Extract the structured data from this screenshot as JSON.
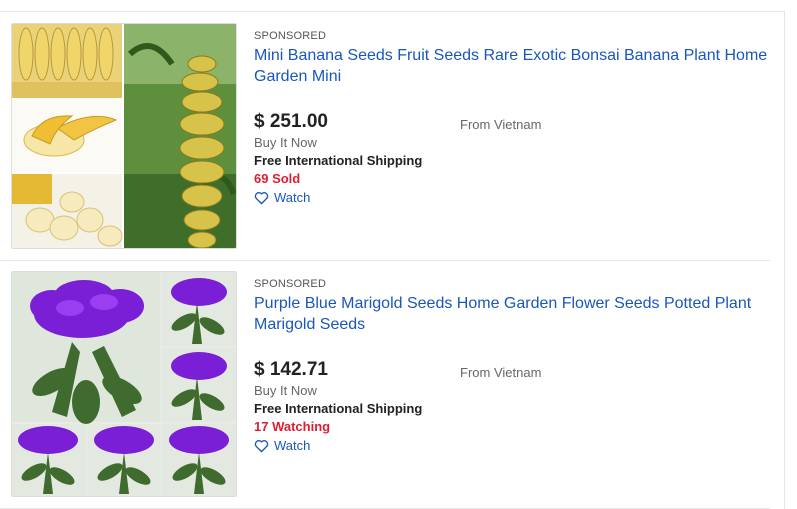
{
  "listings": [
    {
      "sponsored_label": "SPONSORED",
      "title": "Mini Banana Seeds Fruit Seeds Rare Exotic Bonsai Banana Plant Home Garden Mini",
      "price": "$ 251.00",
      "format": "Buy It Now",
      "shipping": "Free International Shipping",
      "hotness": "69 Sold",
      "location": "From Vietnam",
      "watch_label": "Watch",
      "image_icon": "banana-collage-image"
    },
    {
      "sponsored_label": "SPONSORED",
      "title": "Purple Blue Marigold Seeds Home Garden Flower Seeds Potted Plant Marigold Seeds",
      "price": "$ 142.71",
      "format": "Buy It Now",
      "shipping": "Free International Shipping",
      "hotness": "17 Watching",
      "location": "From Vietnam",
      "watch_label": "Watch",
      "image_icon": "marigold-collage-image"
    }
  ],
  "colors": {
    "link": "#1a56bb",
    "hotness": "#dd1e31",
    "price": "#222222",
    "divider": "#e5e5e5"
  }
}
